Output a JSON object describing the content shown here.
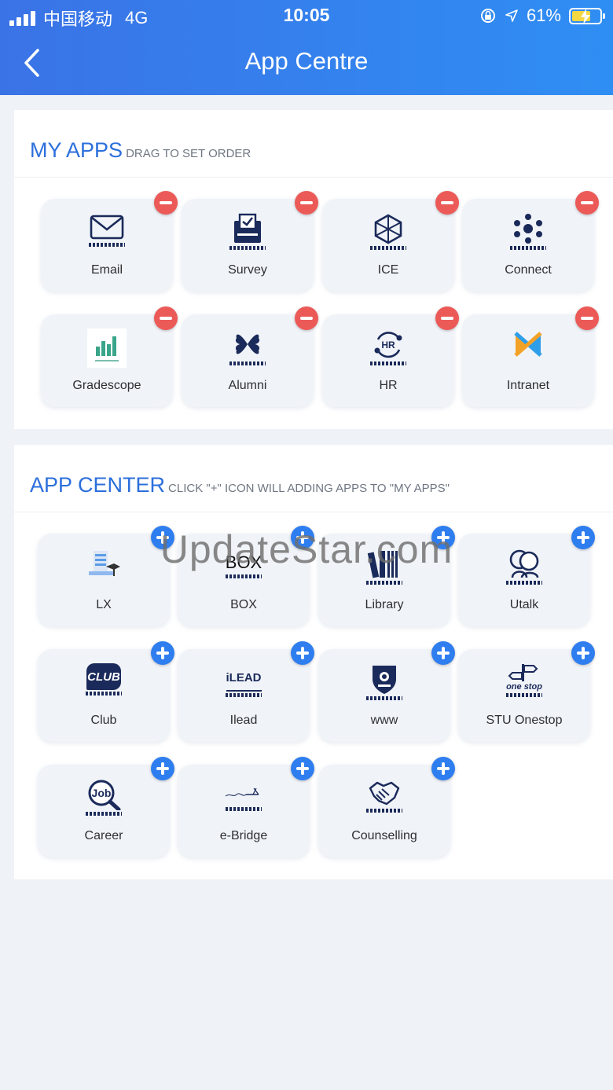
{
  "status_bar": {
    "carrier": "中国移动",
    "network": "4G",
    "time": "10:05",
    "battery": "61%",
    "battery_level": 0.61
  },
  "header": {
    "title": "App Centre",
    "back_icon": "chevron-left-icon"
  },
  "my_apps": {
    "title": "MY APPS",
    "subtitle": "DRAG TO SET ORDER",
    "items": [
      {
        "label": "Email",
        "icon": "envelope-icon"
      },
      {
        "label": "Survey",
        "icon": "survey-icon"
      },
      {
        "label": "ICE",
        "icon": "cube-icon"
      },
      {
        "label": "Connect",
        "icon": "connect-icon"
      },
      {
        "label": "Gradescope",
        "icon": "gradescope-icon"
      },
      {
        "label": "Alumni",
        "icon": "alumni-icon"
      },
      {
        "label": "HR",
        "icon": "hr-icon"
      },
      {
        "label": "Intranet",
        "icon": "intranet-icon"
      }
    ]
  },
  "app_center": {
    "title": "APP CENTER",
    "subtitle": "CLICK \"+\" ICON WILL ADDING APPS TO \"MY APPS\"",
    "items": [
      {
        "label": "LX",
        "icon": "lx-icon"
      },
      {
        "label": "BOX",
        "icon": "box-icon",
        "icon_text": "BOX"
      },
      {
        "label": "Library",
        "icon": "library-icon"
      },
      {
        "label": "Utalk",
        "icon": "utalk-icon"
      },
      {
        "label": "Club",
        "icon": "club-icon",
        "icon_text": "CLUB"
      },
      {
        "label": "Ilead",
        "icon": "ilead-icon",
        "icon_text": "iLEAD"
      },
      {
        "label": "www",
        "icon": "shield-icon"
      },
      {
        "label": "STU Onestop",
        "icon": "onestop-icon",
        "icon_text": "one stop"
      },
      {
        "label": "Career",
        "icon": "job-search-icon",
        "icon_text": "Job"
      },
      {
        "label": "e-Bridge",
        "icon": "ebridge-icon"
      },
      {
        "label": "Counselling",
        "icon": "handshake-icon"
      }
    ]
  },
  "watermark": "UpdateStar.com",
  "colors": {
    "header_start": "#3a73e6",
    "header_end": "#2f8ef3",
    "accent_blue": "#2c6fdc",
    "remove_red": "#ec5a58",
    "add_blue": "#2f7ef0",
    "icon_navy": "#1a2a5a"
  }
}
